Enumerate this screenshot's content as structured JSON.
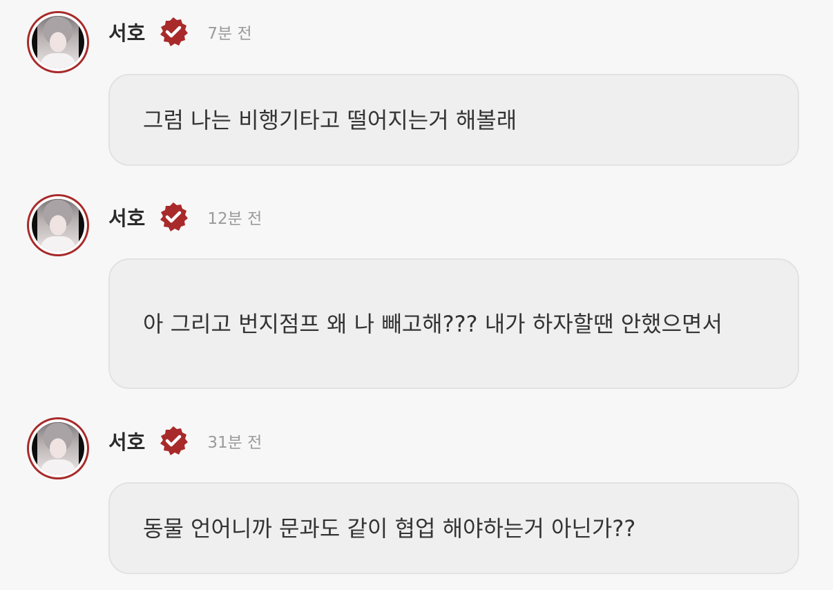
{
  "messages": [
    {
      "author": "서호",
      "time": "7분 전",
      "text": "그럼 나는 비행기타고 떨어지는거 해볼래"
    },
    {
      "author": "서호",
      "time": "12분 전",
      "text": "아 그리고 번지점프 왜 나 빼고해??? 내가 하자할땐 안했으면서"
    },
    {
      "author": "서호",
      "time": "31분 전",
      "text": "동물 언어니까 문과도 같이 협업 해야하는거 아닌가??"
    }
  ],
  "colors": {
    "background": "#f7f7f7",
    "bubble": "#efefef",
    "bubble_border": "#e2e2e2",
    "accent_badge": "#a82a2a",
    "name_text": "#2b2b2b",
    "time_text": "#9a9a9a"
  },
  "icons": {
    "verified_badge": "verified-badge-icon"
  }
}
